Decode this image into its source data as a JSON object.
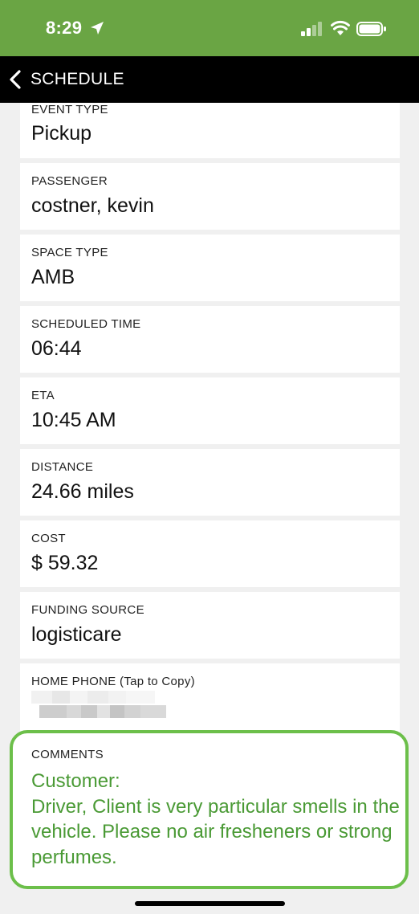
{
  "status_bar": {
    "time": "8:29"
  },
  "nav": {
    "back_title": "SCHEDULE"
  },
  "fields": [
    {
      "label": "EVENT TYPE",
      "value": "Pickup"
    },
    {
      "label": "PASSENGER",
      "value": "costner, kevin"
    },
    {
      "label": "SPACE TYPE",
      "value": "AMB"
    },
    {
      "label": "SCHEDULED TIME",
      "value": "06:44"
    },
    {
      "label": "ETA",
      "value": "10:45 AM"
    },
    {
      "label": "DISTANCE",
      "value": "24.66 miles"
    },
    {
      "label": "COST",
      "value": "$ 59.32"
    },
    {
      "label": "FUNDING SOURCE",
      "value": "logisticare"
    }
  ],
  "home_phone": {
    "label": "HOME PHONE (Tap to Copy)",
    "value": ""
  },
  "comments": {
    "label": "COMMENTS",
    "text": "Customer:\nDriver, Client is very particular smells in the vehicle. Please no air fresheners or strong perfumes."
  },
  "colors": {
    "status_bar": "#6aa544",
    "nav_bar": "#000000",
    "comments_border": "#6cbf4a",
    "comments_text": "#4a9a35"
  }
}
